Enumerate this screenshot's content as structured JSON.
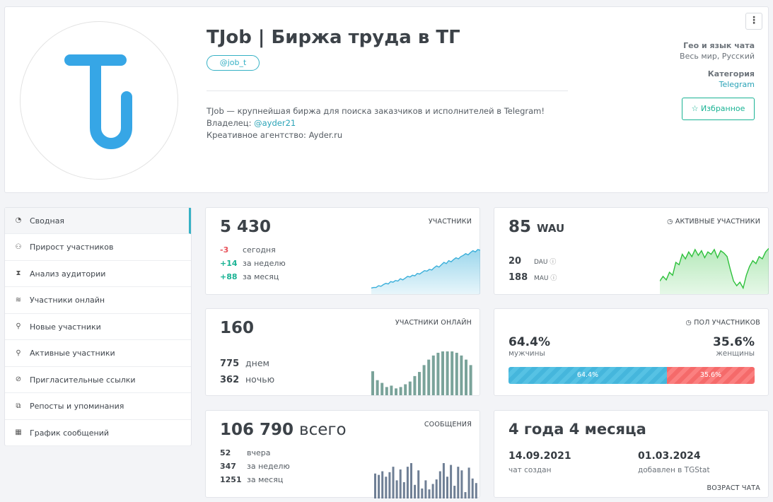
{
  "channel": {
    "title": "TJob | Биржа труда в ТГ",
    "username": "@job_t",
    "description_line1": "TJob — крупнейшая биржа для поиска заказчиков и исполнителей в Telegram!",
    "owner_prefix": "Владелец: ",
    "owner_link": "@ayder21",
    "agency": "Креативное агентство: Ayder.ru",
    "avatar_color": "#36a6e6"
  },
  "meta": {
    "geo_label": "Гео и язык чата",
    "geo_value": "Весь мир, Русский",
    "category_label": "Категория",
    "category_value": "Telegram",
    "favorite_label": "Избранное"
  },
  "menu_icon": "⋮",
  "sidebar": {
    "items": [
      {
        "label": "Сводная",
        "icon": "dashboard-icon",
        "active": true
      },
      {
        "label": "Прирост участников",
        "icon": "users-icon"
      },
      {
        "label": "Анализ аудитории",
        "icon": "hourglass-icon"
      },
      {
        "label": "Участники онлайн",
        "icon": "wifi-icon"
      },
      {
        "label": "Новые участники",
        "icon": "user-plus-icon"
      },
      {
        "label": "Активные участники",
        "icon": "user-active-icon"
      },
      {
        "label": "Пригласительные ссылки",
        "icon": "link-icon"
      },
      {
        "label": "Репосты и упоминания",
        "icon": "repost-icon"
      },
      {
        "label": "График сообщений",
        "icon": "calendar-icon"
      }
    ]
  },
  "subscribers": {
    "total": "5 430",
    "label": "УЧАСТНИКИ",
    "rows": [
      {
        "value": "-3",
        "label": "сегодня",
        "trend": "down"
      },
      {
        "value": "+14",
        "label": "за неделю",
        "trend": "up"
      },
      {
        "value": "+88",
        "label": "за месяц",
        "trend": "up"
      }
    ],
    "color": "#3aafda"
  },
  "active": {
    "total": "85",
    "suffix": "WAU",
    "label": "АКТИВНЫЕ УЧАСТНИКИ",
    "rows": [
      {
        "value": "20",
        "label": "DAU"
      },
      {
        "value": "188",
        "label": "MAU"
      }
    ],
    "color": "#2ec13c"
  },
  "online": {
    "total": "160",
    "label": "УЧАСТНИКИ ОНЛАЙН",
    "rows": [
      {
        "value": "775",
        "label": "днем"
      },
      {
        "value": "362",
        "label": "ночью"
      }
    ],
    "color": "#7aa39a"
  },
  "gender": {
    "label": "ПОЛ УЧАСТНИКОВ",
    "male_pct": "64.4%",
    "male_label": "мужчины",
    "female_pct": "35.6%",
    "female_label": "женщины",
    "male_fraction": 0.644,
    "male_color": "#45b6dc",
    "female_color": "#f56a6a"
  },
  "messages": {
    "total": "106 790",
    "suffix": "всего",
    "label": "СООБЩЕНИЯ",
    "rows": [
      {
        "value": "52",
        "label": "вчера"
      },
      {
        "value": "347",
        "label": "за неделю"
      },
      {
        "value": "1251",
        "label": "за месяц"
      }
    ],
    "color": "#6f7f95"
  },
  "age": {
    "title": "4 года 4 месяца",
    "created_date": "14.09.2021",
    "created_label": "чат создан",
    "added_date": "01.03.2024",
    "added_label": "добавлен в TGStat",
    "label": "ВОЗРАСТ ЧАТА"
  },
  "chart_data": [
    {
      "type": "area",
      "series": [
        {
          "values": [
            8,
            9,
            9,
            12,
            11,
            14,
            16,
            15,
            19,
            18,
            21,
            20,
            24,
            22,
            25,
            28,
            27,
            30,
            29,
            33,
            32,
            35,
            38,
            37,
            40,
            39,
            43,
            46,
            44,
            48,
            52,
            50,
            55,
            53,
            57,
            60,
            58,
            62,
            64,
            67,
            65,
            69,
            72,
            70,
            74,
            73
          ]
        }
      ]
    },
    {
      "type": "area",
      "series": [
        {
          "values": [
            20,
            28,
            22,
            35,
            30,
            52,
            48,
            66,
            58,
            70,
            62,
            74,
            64,
            72,
            60,
            70,
            66,
            74,
            60,
            72,
            68,
            62,
            40,
            20,
            12,
            18,
            8,
            30,
            45,
            55,
            50,
            62,
            58,
            70,
            76
          ]
        }
      ]
    },
    {
      "type": "bar",
      "values": [
        35,
        22,
        18,
        12,
        14,
        10,
        12,
        16,
        20,
        28,
        34,
        44,
        52,
        58,
        62,
        64,
        64,
        64,
        62,
        58,
        52,
        44
      ]
    },
    {
      "type": "bar",
      "values": [
        55,
        52,
        60,
        48,
        58,
        70,
        40,
        64,
        36,
        70,
        78,
        30,
        62,
        22,
        40,
        20,
        32,
        42,
        60,
        78,
        48,
        74,
        28,
        70,
        62,
        14,
        68,
        44,
        34
      ]
    }
  ]
}
